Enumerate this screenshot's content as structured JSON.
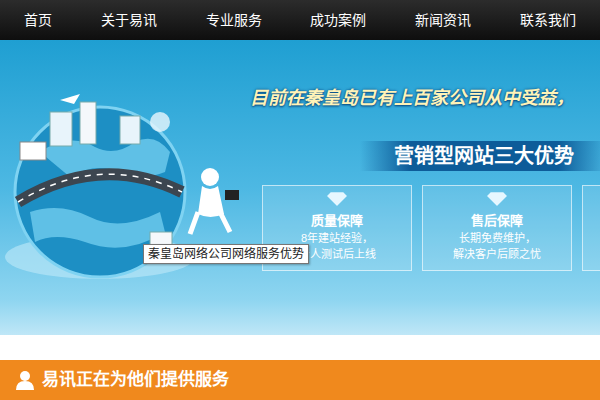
{
  "nav": {
    "items": [
      {
        "label": "首页"
      },
      {
        "label": "关于易讯"
      },
      {
        "label": "专业服务"
      },
      {
        "label": "成功案例"
      },
      {
        "label": "新闻资讯"
      },
      {
        "label": "联系我们"
      }
    ]
  },
  "banner": {
    "headline": "目前在秦皇岛已有上百家公司从中受益，",
    "title": "营销型网站三大优势",
    "features": [
      {
        "title": "质量保障",
        "lines": [
          "8年建站经验，",
          "专人测试后上线"
        ]
      },
      {
        "title": "售后保障",
        "lines": [
          "长期免费维护，",
          "解决客户后顾之忧"
        ]
      }
    ]
  },
  "tooltip": {
    "text": "秦皇岛网络公司网络服务优势"
  },
  "section": {
    "title": "易讯正在为他们提供服务"
  }
}
